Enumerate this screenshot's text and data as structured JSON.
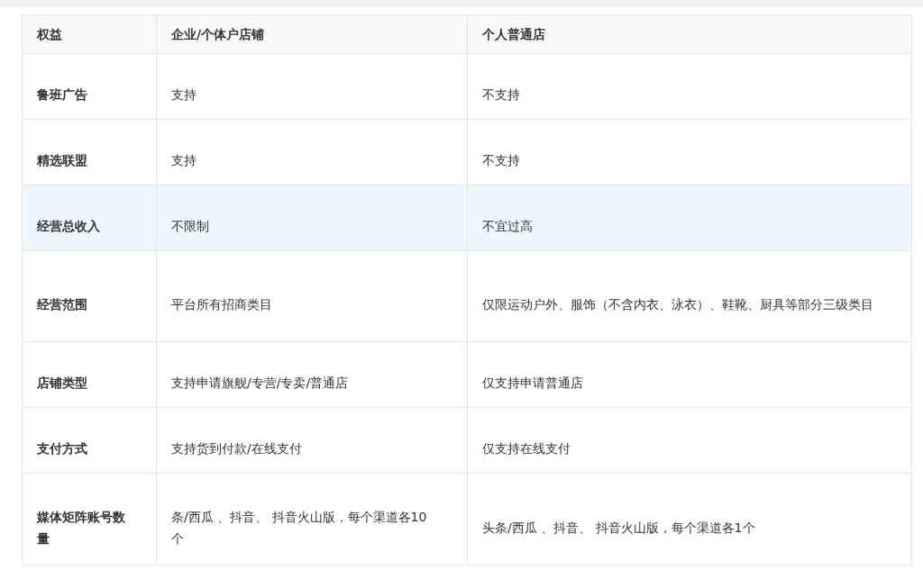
{
  "table": {
    "columns": [
      "权益",
      "企业/个体户店铺",
      "个人普通店"
    ],
    "rows": [
      {
        "cells": [
          "鲁班广告",
          "支持",
          "不支持"
        ],
        "highlighted": false
      },
      {
        "cells": [
          "精选联盟",
          "支持",
          "不支持"
        ],
        "highlighted": false
      },
      {
        "cells": [
          "经营总收入",
          "不限制",
          "不宜过高"
        ],
        "highlighted": true
      },
      {
        "cells": [
          "经营范围",
          "平台所有招商类目",
          "仅限运动户外、服饰（不含内衣、泳衣）、鞋靴、厨具等部分三级类目"
        ],
        "highlighted": false
      },
      {
        "cells": [
          "店铺类型",
          "支持申请旗舰/专营/专卖/普通店",
          "仅支持申请普通店"
        ],
        "highlighted": false
      },
      {
        "cells": [
          "支付方式",
          "支持货到付款/在线支付",
          "仅支持在线支付"
        ],
        "highlighted": false
      },
      {
        "cells": [
          "媒体矩阵账号数量",
          "条/西瓜 、抖音、 抖音火山版，每个渠道各10个",
          "头条/西瓜 、抖音、 抖音火山版，每个渠道各1个"
        ],
        "highlighted": false
      }
    ]
  }
}
